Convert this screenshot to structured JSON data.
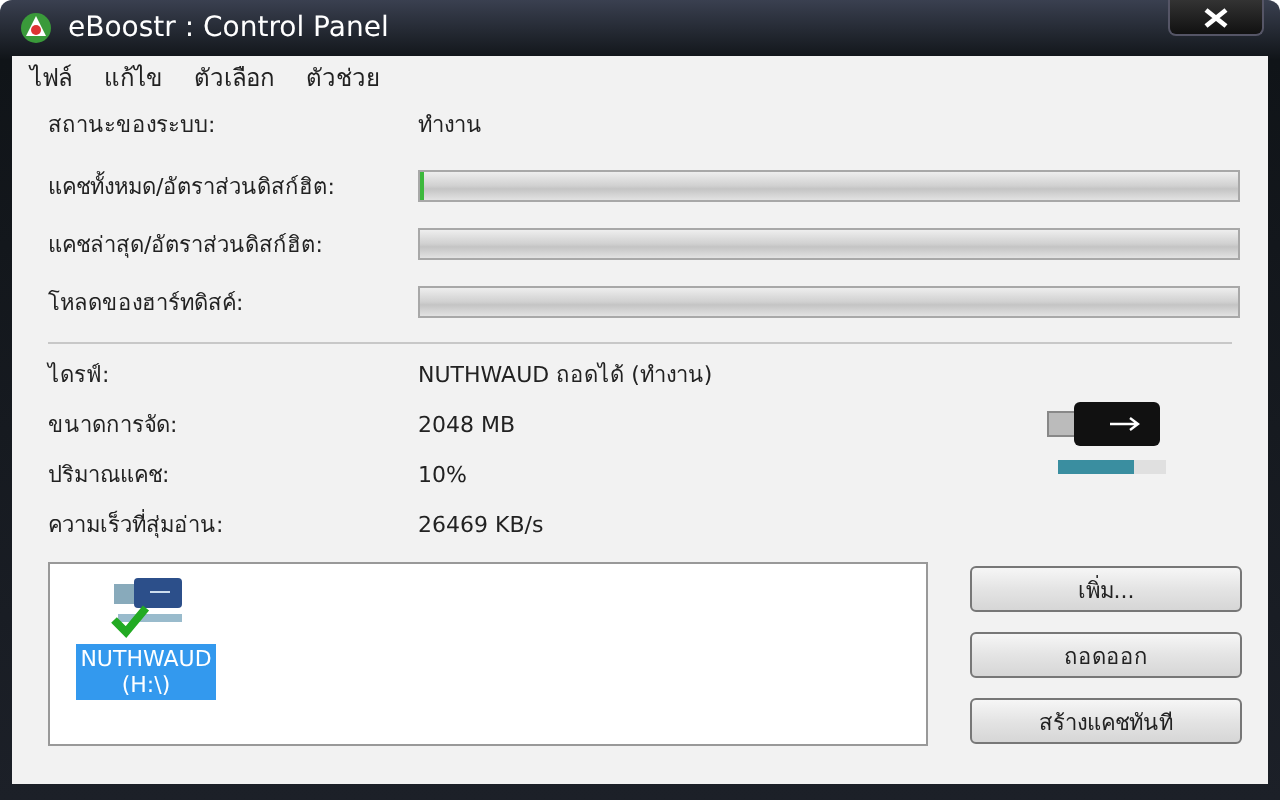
{
  "window": {
    "title": "eBoostr : Control Panel"
  },
  "menu": [
    "ไฟล์",
    "แก้ไข",
    "ตัวเลือก",
    "ตัวช่วย"
  ],
  "status": {
    "label": "สถานะของระบบ:",
    "value": "ทำงาน"
  },
  "meters": [
    {
      "label": "แคชทั้งหมด/อัตราส่วนดิสก์ฮิต:",
      "level": 0.005
    },
    {
      "label": "แคชล่าสุด/อัตราส่วนดิสก์ฮิต:",
      "level": 0
    },
    {
      "label": "โหลดของฮาร์ทดิสค์:",
      "level": 0
    }
  ],
  "info": [
    {
      "label": "ไดรฟ์:",
      "value": "NUTHWAUD ถอดได้ (ทำงาน)"
    },
    {
      "label": "ขนาดการจัด:",
      "value": "2048 MB"
    },
    {
      "label": "ปริมาณแคช:",
      "value": "10%"
    },
    {
      "label": "ความเร็วที่สุ่มอ่าน:",
      "value": "26469 KB/s"
    }
  ],
  "device_usage": {
    "level": 0.7
  },
  "drives": [
    {
      "name": "NUTHWAUD",
      "letter": "(H:\\)",
      "selected": true
    }
  ],
  "buttons": [
    "เพิ่ม...",
    "ถอดออก",
    "สร้างแคชทันที"
  ]
}
